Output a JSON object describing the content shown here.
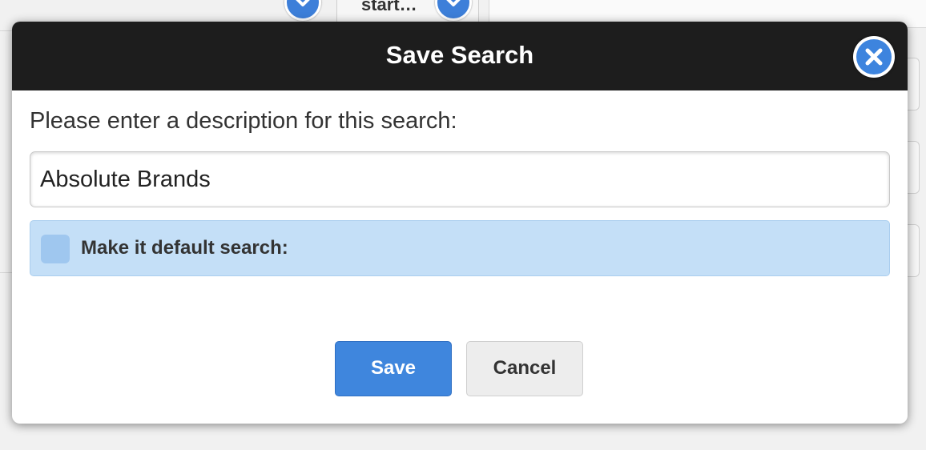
{
  "background": {
    "toolbar_label": "start…",
    "toolbar_icon": "chevron-down-icon"
  },
  "dialog": {
    "title": "Save Search",
    "close_icon": "close-icon",
    "prompt": "Please enter a description for this search:",
    "description_value": "Absolute Brands",
    "default_checkbox_checked": false,
    "default_label": "Make it default search:",
    "save_label": "Save",
    "cancel_label": "Cancel"
  },
  "colors": {
    "header_bg": "#1d1d1d",
    "accent": "#3f86dd",
    "default_row_bg": "#c4dff7",
    "cancel_bg": "#ededed"
  }
}
